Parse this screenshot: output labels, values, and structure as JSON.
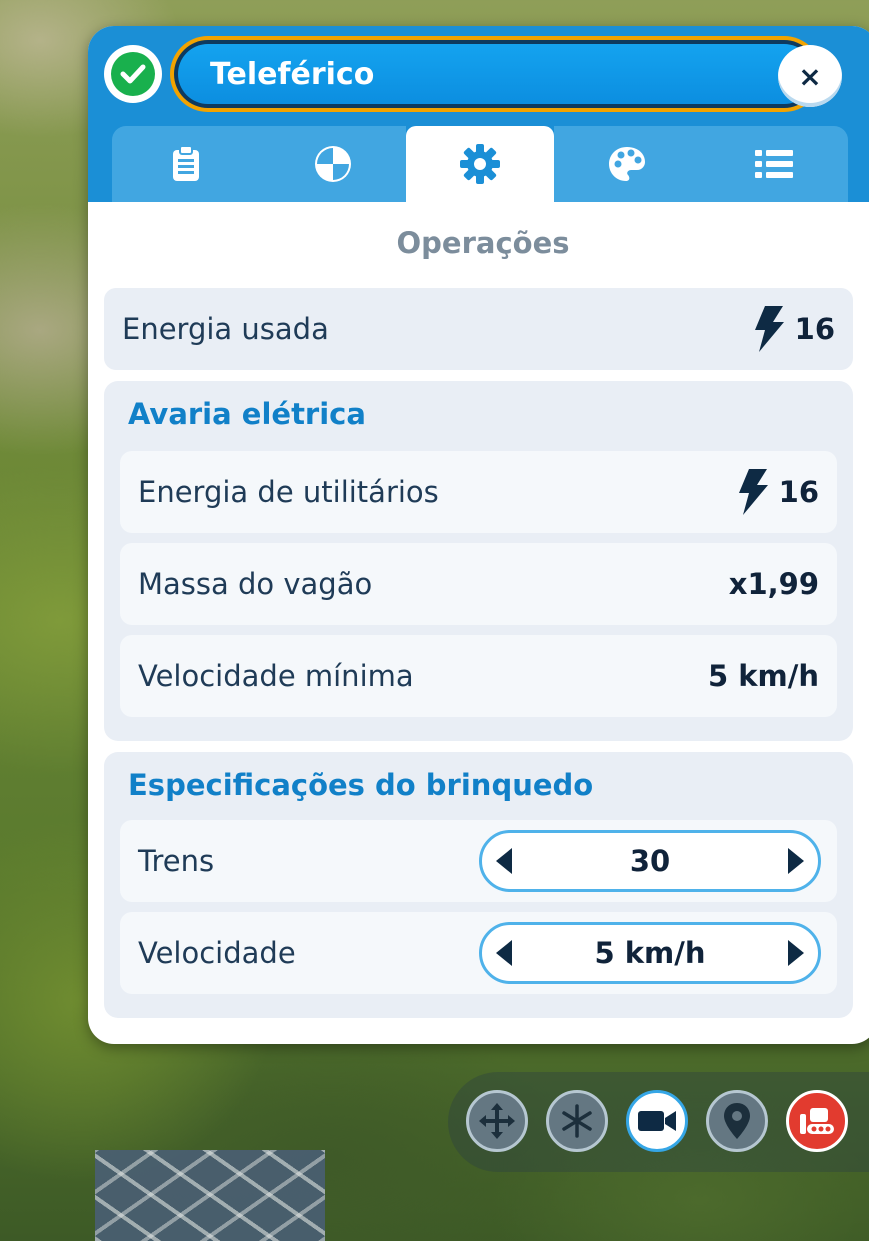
{
  "window": {
    "name": "Teleférico",
    "close_label": "×"
  },
  "tabs": [
    {
      "icon": "clipboard-icon",
      "active": false
    },
    {
      "icon": "rating-icon",
      "active": false
    },
    {
      "icon": "gear-icon",
      "active": true
    },
    {
      "icon": "palette-icon",
      "active": false
    },
    {
      "icon": "list-icon",
      "active": false
    }
  ],
  "section_title": "Operações",
  "power_used": {
    "label": "Energia usada",
    "value": "16",
    "icon": "lightning-icon"
  },
  "breakdown": {
    "title": "Avaria elétrica",
    "rows": [
      {
        "label": "Energia de utilitários",
        "value": "16",
        "icon": "lightning-icon"
      },
      {
        "label": "Massa do vagão",
        "value": "x1,99"
      },
      {
        "label": "Velocidade mínima",
        "value": "5 km/h"
      }
    ]
  },
  "specs": {
    "title": "Especificações do brinquedo",
    "rows": [
      {
        "label": "Trens",
        "value": "30"
      },
      {
        "label": "Velocidade",
        "value": "5 km/h"
      }
    ]
  },
  "toolbar": [
    {
      "icon": "move-icon"
    },
    {
      "icon": "freeze-icon"
    },
    {
      "icon": "camera-icon",
      "active": true
    },
    {
      "icon": "location-pin-icon"
    },
    {
      "icon": "bulldozer-icon",
      "danger": true
    }
  ],
  "colors": {
    "header_blue": "#1b8fd6",
    "accent_orange": "#f2a300",
    "status_green": "#19b04d",
    "title_blue": "#1180c8",
    "danger_red": "#e23b2f"
  }
}
